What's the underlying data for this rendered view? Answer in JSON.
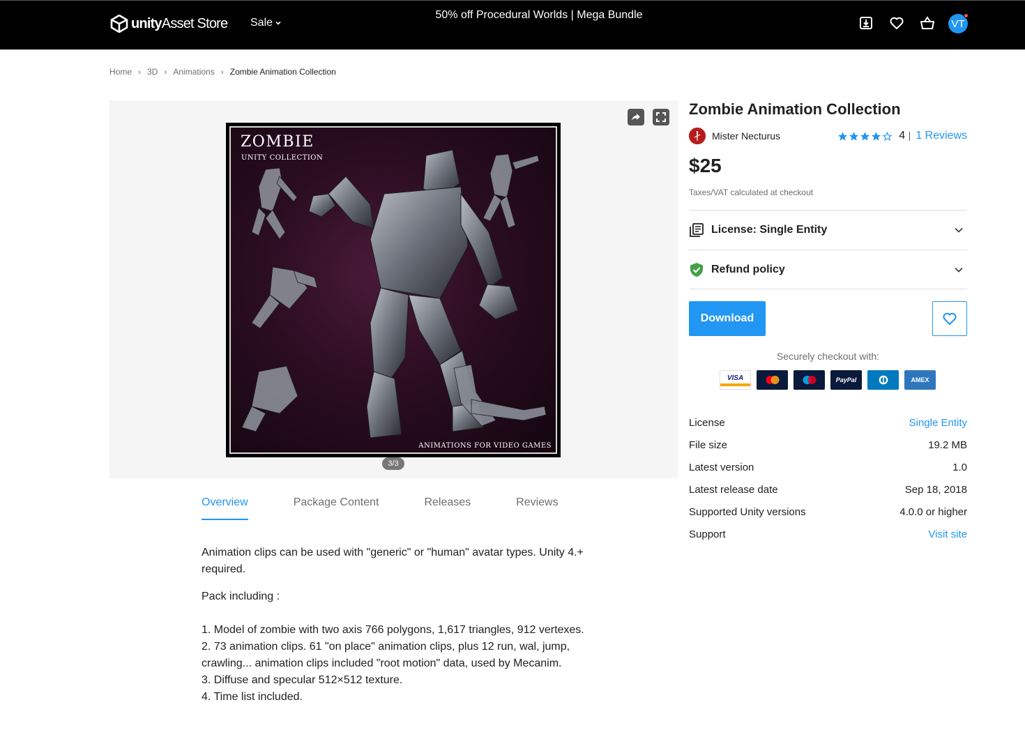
{
  "header": {
    "logo_brand": "unity",
    "logo_product": "Asset Store",
    "sale_label": "Sale",
    "promo_text": "50% off Procedural Worlds | Mega Bundle",
    "avatar_initials": "VT"
  },
  "breadcrumb": [
    "Home",
    "3D",
    "Animations",
    "Zombie Animation Collection"
  ],
  "gallery": {
    "image_title": "ZOMBIE",
    "image_subtitle": "UNITY COLLECTION",
    "image_footer": "ANIMATIONS FOR VIDEO GAMES",
    "counter": "3/3"
  },
  "tabs": [
    {
      "label": "Overview",
      "active": true
    },
    {
      "label": "Package Content",
      "active": false
    },
    {
      "label": "Releases",
      "active": false
    },
    {
      "label": "Reviews",
      "active": false
    }
  ],
  "description": {
    "intro": "Animation clips can be used with \"generic\" or \"human\" avatar types. Unity 4.+ required.",
    "pack_heading": "Pack including :",
    "items": [
      "1. Model of zombie with two axis 766 polygons, 1,617 triangles, 912 vertexes.",
      "2. 73 animation clips. 61 \"on place\" animation clips, plus 12 run, wal, jump, crawling... animation clips included \"root motion\" data, used by Mecanim.",
      "3. Diffuse and specular 512×512 texture.",
      "4. Time list included."
    ]
  },
  "product": {
    "title": "Zombie Animation Collection",
    "publisher": "Mister Necturus",
    "rating_value": "4",
    "rating_stars": 4,
    "reviews_label": "1 Reviews",
    "price": "$25",
    "tax_note": "Taxes/VAT calculated at checkout",
    "license_accordion": "License: Single Entity",
    "refund_accordion": "Refund policy",
    "download_label": "Download",
    "secure_label": "Securely checkout with:",
    "payment_cards": [
      "VISA",
      "Mastercard",
      "Maestro",
      "PayPal",
      "Diners",
      "AMEX"
    ]
  },
  "details": [
    {
      "label": "License",
      "value": "Single Entity",
      "link": true
    },
    {
      "label": "File size",
      "value": "19.2 MB",
      "link": false
    },
    {
      "label": "Latest version",
      "value": "1.0",
      "link": false
    },
    {
      "label": "Latest release date",
      "value": "Sep 18, 2018",
      "link": false
    },
    {
      "label": "Supported Unity versions",
      "value": "4.0.0 or higher",
      "link": false
    },
    {
      "label": "Support",
      "value": "Visit site",
      "link": true
    }
  ],
  "colors": {
    "accent": "#2196f3",
    "topbar": "#000000",
    "gallery_bg": "#f5f5f5",
    "refund_green": "#43a047"
  }
}
